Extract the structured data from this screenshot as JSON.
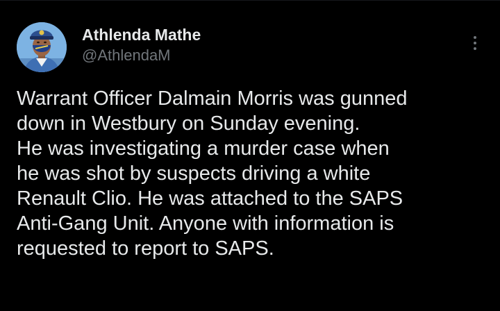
{
  "tweet": {
    "author": {
      "display_name": "Athlenda Mathe",
      "handle": "@AthlendaM",
      "avatar_icon": "profile-photo-police-officer"
    },
    "more_icon": "more-vertical-icon",
    "text_lines": [
      "Warrant Officer Dalmain Morris was gunned",
      "down in Westbury on Sunday evening.",
      "He was investigating a murder case when",
      "he was shot by suspects driving a white",
      "Renault Clio. He was attached to the SAPS",
      "Anti-Gang Unit. Anyone with information is",
      "requested to report to SAPS."
    ]
  },
  "colors": {
    "background": "#000000",
    "primary_text": "#e7e9ea",
    "secondary_text": "#71767b"
  }
}
